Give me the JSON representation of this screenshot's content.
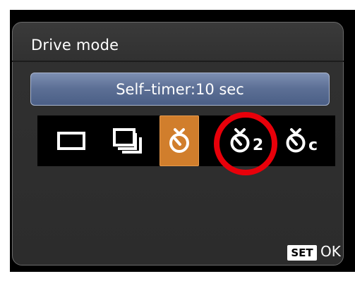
{
  "menu": {
    "title": "Drive mode",
    "selected_mode_label": "Self–timer:10 sec"
  },
  "drive_modes": [
    {
      "icon": "single-shot-icon",
      "selected": false
    },
    {
      "icon": "continuous-shot-icon",
      "selected": false
    },
    {
      "icon": "self-timer-10sec-icon",
      "selected": true
    },
    {
      "icon": "self-timer-2sec-icon",
      "selected": false,
      "suffix": "2",
      "highlighted": true
    },
    {
      "icon": "self-timer-continuous-icon",
      "selected": false,
      "suffix": "c"
    }
  ],
  "footer": {
    "set_label": "SET",
    "ok_label": "OK"
  },
  "colors": {
    "selected_option": "#d17e2c",
    "mode_bar": "#5c6f95",
    "highlight_ring": "#e8000a",
    "panel": "#303030",
    "background": "#000000"
  }
}
